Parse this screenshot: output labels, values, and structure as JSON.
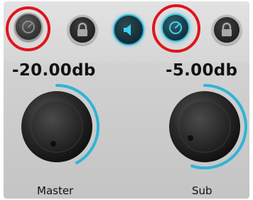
{
  "colors": {
    "accent": "#2fb4d6",
    "highlight_ring": "#e0141b",
    "panel": "#d4d4d4",
    "knob": "#2a2a2a"
  },
  "top_buttons": [
    {
      "icon": "gauge-icon",
      "state": "inactive",
      "highlighted": true
    },
    {
      "icon": "lock-icon",
      "state": "inactive",
      "highlighted": false
    },
    {
      "icon": "speaker-icon",
      "state": "active",
      "highlighted": false
    },
    {
      "icon": "gauge-icon",
      "state": "active",
      "highlighted": true
    },
    {
      "icon": "lock-icon",
      "state": "inactive",
      "highlighted": false
    }
  ],
  "master": {
    "value": "-20.00db",
    "caption": "Master",
    "arc_level": 0.42
  },
  "sub": {
    "value": "-5.00db",
    "caption": "Sub",
    "arc_level": 0.55
  }
}
